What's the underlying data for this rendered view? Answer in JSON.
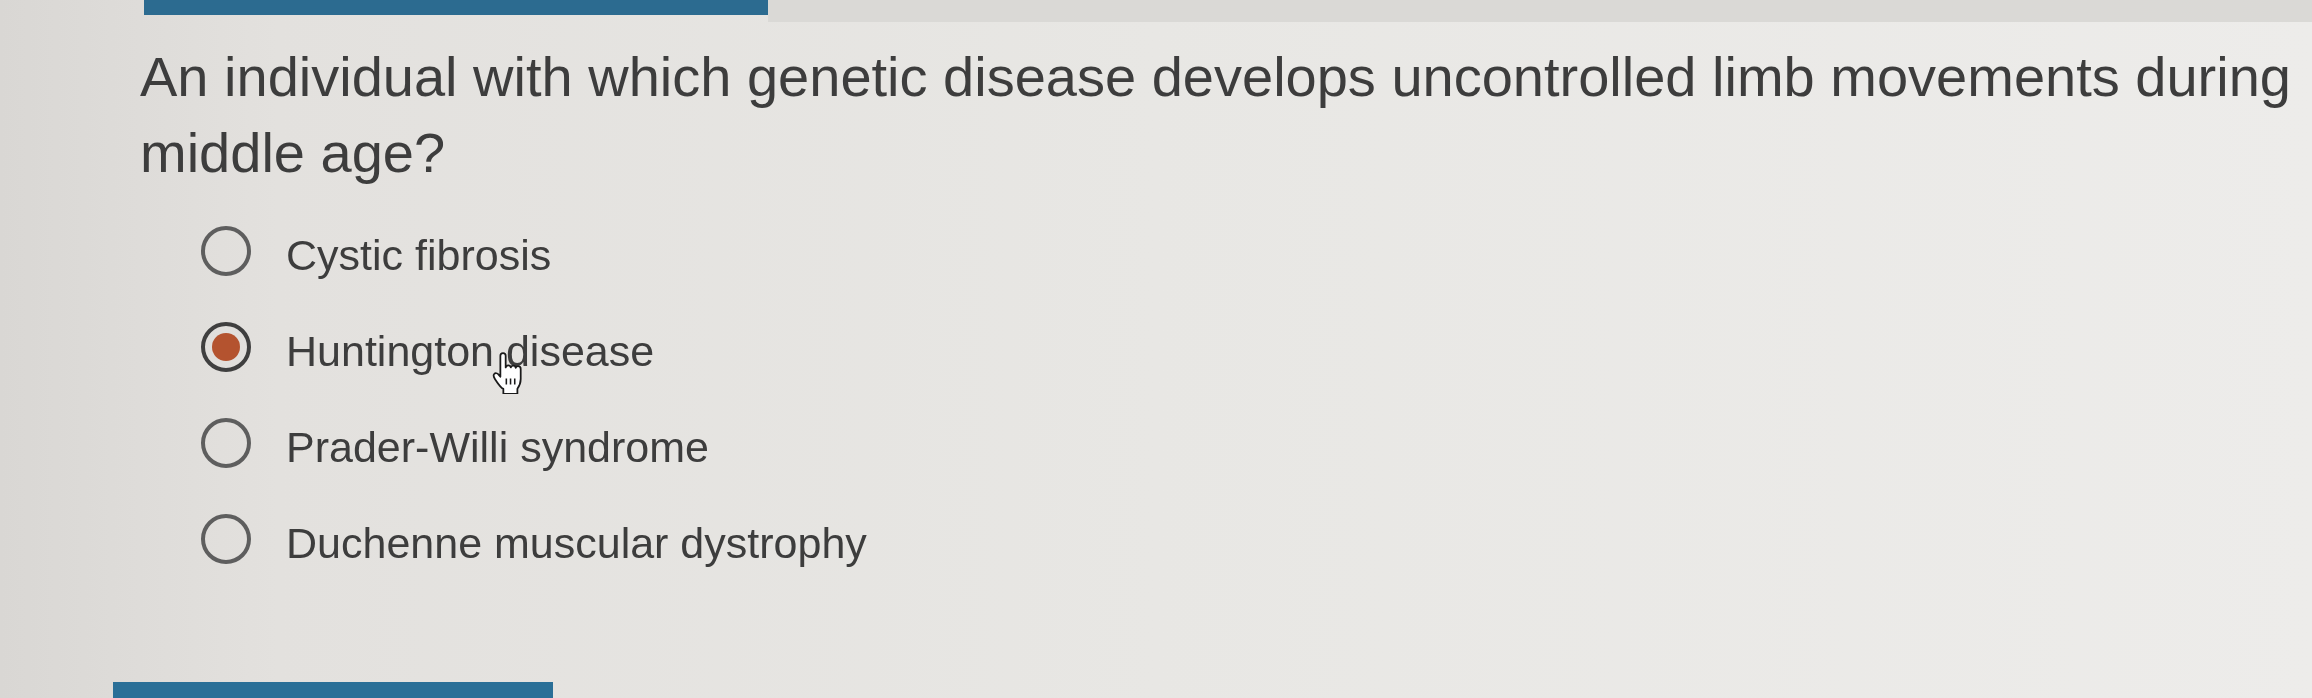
{
  "question": {
    "text": "An individual with which genetic disease develops uncontrolled limb movements during middle age?"
  },
  "options": [
    {
      "label": "Cystic fibrosis",
      "selected": false
    },
    {
      "label": "Huntington disease",
      "selected": true
    },
    {
      "label": "Prader-Willi syndrome",
      "selected": false
    },
    {
      "label": "Duchenne muscular dystrophy",
      "selected": false
    }
  ]
}
